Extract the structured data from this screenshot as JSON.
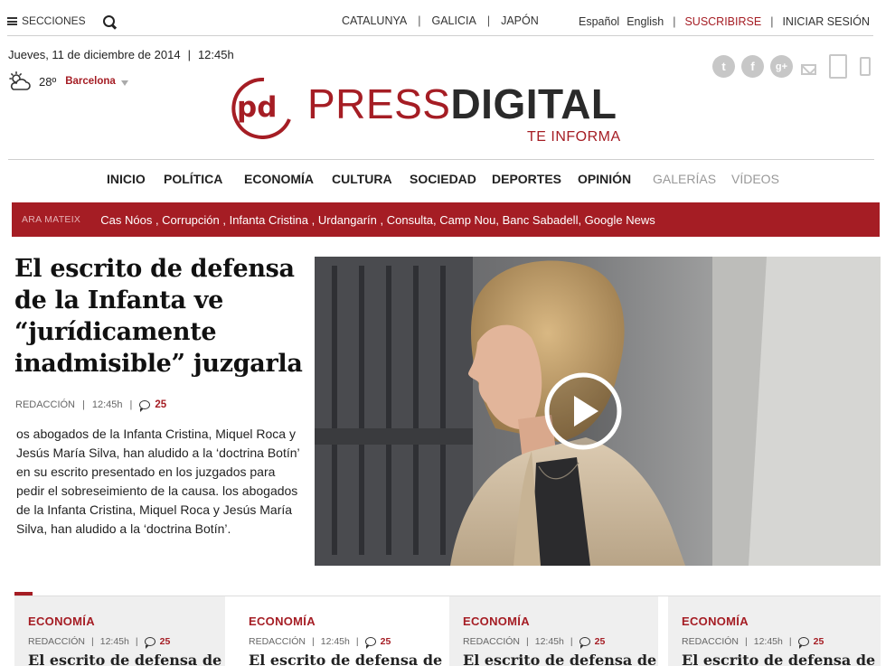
{
  "topbar": {
    "secciones": "SECCIONES",
    "regions": [
      "CATALUNYA",
      "GALICIA",
      "JAPÓN"
    ],
    "languages": [
      "Español",
      "English"
    ],
    "subscribe": "SUSCRIBIRSE",
    "login": "INICIAR SESIÓN",
    "separator": "|"
  },
  "dateline": {
    "date": "Jueves, 11 de diciembre de 2014",
    "time": "12:45h"
  },
  "weather": {
    "temp": "28º",
    "city": "Barcelona"
  },
  "logo": {
    "mark": "pd",
    "press": "PRESS",
    "digital": "DIGITAL",
    "tagline": "TE INFORMA"
  },
  "social": {
    "twitter": "t",
    "facebook": "f",
    "gplus": "g+"
  },
  "nav": [
    {
      "label": "INICIO",
      "active": true
    },
    {
      "label": "POLÍTICA",
      "active": true
    },
    {
      "label": "ECONOMÍA",
      "active": true
    },
    {
      "label": "CULTURA",
      "active": true
    },
    {
      "label": "SOCIEDAD",
      "active": true
    },
    {
      "label": "DEPORTES",
      "active": true
    },
    {
      "label": "OPINIÓN",
      "active": true
    },
    {
      "label": "GALERÍAS",
      "active": false
    },
    {
      "label": "VÍDEOS",
      "active": false
    }
  ],
  "trending": {
    "label": "ARA MATEIX",
    "tags": "Cas Nóos , Corrupción , Infanta Cristina , Urdangarín ,  Consulta,  Camp Nou, Banc Sabadell, Google News"
  },
  "main_story": {
    "headline": "El escrito de defensa de la Infanta ve “jurídicamente inadmisible” juzgarla",
    "author": "REDACCIÓN",
    "time": "12:45h",
    "comments": "25",
    "lead": "os abogados de la Infanta Cristina, Miquel Roca y Jesús María Silva, han aludido a la ‘doctrina Botín’ en su escrito presentado en los juzgados para pedir el sobreseimiento de la causa. los abogados de la Infanta Cristina, Miquel Roca y Jesús María Silva, han aludido a la ‘doctrina Botín’."
  },
  "cards": [
    {
      "category": "ECONOMÍA",
      "author": "REDACCIÓN",
      "time": "12:45h",
      "comments": "25",
      "title": "El escrito de defensa de la"
    },
    {
      "category": "ECONOMÍA",
      "author": "REDACCIÓN",
      "time": "12:45h",
      "comments": "25",
      "title": "El escrito de defensa de la"
    },
    {
      "category": "ECONOMÍA",
      "author": "REDACCIÓN",
      "time": "12:45h",
      "comments": "25",
      "title": "El escrito de defensa de la"
    },
    {
      "category": "ECONOMÍA",
      "author": "REDACCIÓN",
      "time": "12:45h",
      "comments": "25",
      "title": "El escrito de defensa de la"
    }
  ],
  "colors": {
    "brand_red": "#a51d24",
    "text": "#222222",
    "muted": "#999999",
    "icon_gray": "#c7c7c7"
  }
}
